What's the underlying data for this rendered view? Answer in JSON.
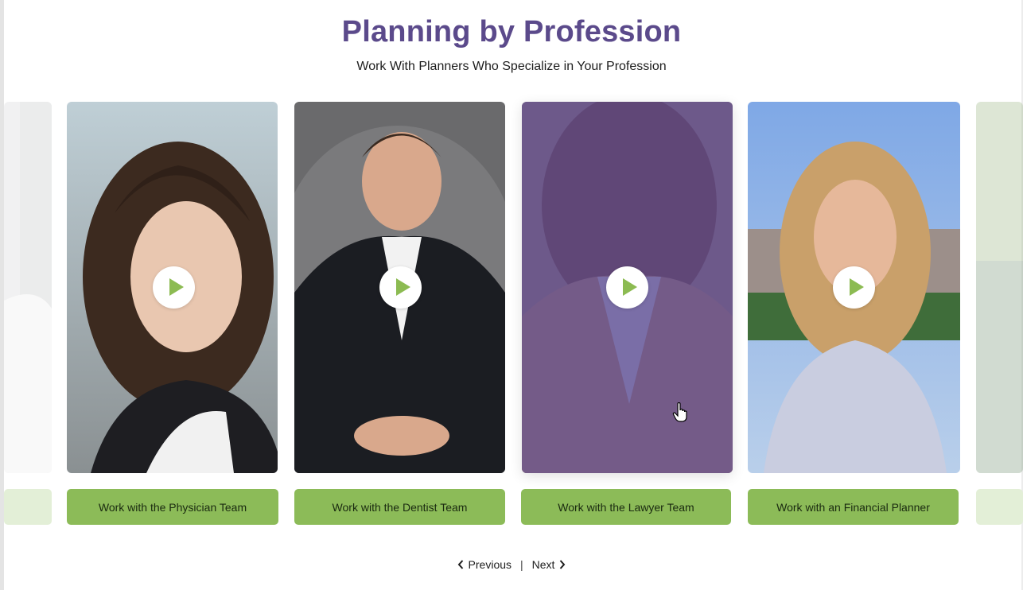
{
  "header": {
    "title": "Planning by Profession",
    "subtitle": "Work With Planners Who Specialize in Your Profession"
  },
  "cards": [
    {
      "button_label": "Work with the Physician Team",
      "icon": "play-icon"
    },
    {
      "button_label": "Work with the Dentist Team",
      "icon": "play-icon"
    },
    {
      "button_label": "Work with the Lawyer Team",
      "icon": "play-icon",
      "state": "hovered"
    },
    {
      "button_label": "Work with an Financial Planner",
      "icon": "play-icon"
    }
  ],
  "pager": {
    "previous_label": "Previous",
    "separator": "|",
    "next_label": "Next"
  },
  "colors": {
    "title": "#5b4a8b",
    "button": "#8cbb58",
    "play_triangle": "#8cbb52",
    "hover_overlay": "#624c94"
  }
}
